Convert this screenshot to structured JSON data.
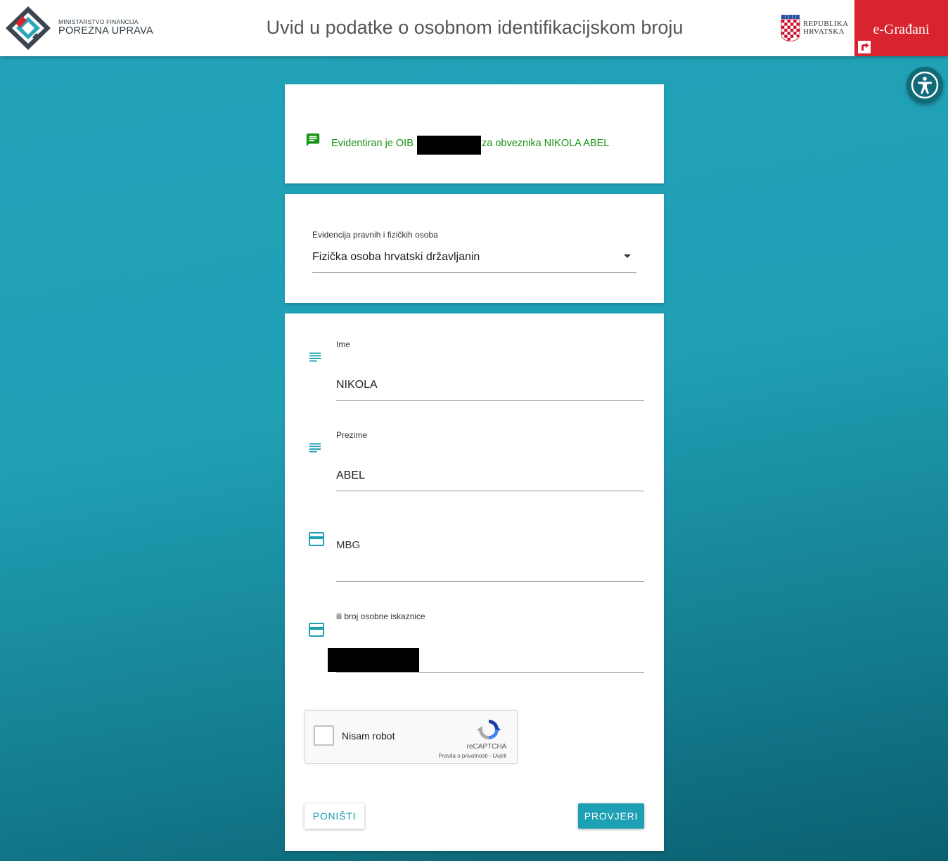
{
  "header": {
    "logo_line1": "MINISTARSTVO FINANCIJA",
    "logo_line2": "POREZNA UPRAVA",
    "title": "Uvid u podatke o osobnom identifikacijskom broju",
    "republic_line1": "REPUBLIKA",
    "republic_line2": "HRVATSKA",
    "egradjani_label": "e-Građani"
  },
  "message": {
    "text_before": "Evidentiran je OIB",
    "text_after": "za obveznika NIKOLA ABEL",
    "icon": "message-icon",
    "color": "#179317"
  },
  "registry_select": {
    "label": "Evidencija pravnih i fizičkih osoba",
    "value": "Fizička osoba hrvatski državljanin"
  },
  "form": {
    "first_name": {
      "label": "Ime",
      "value": "NIKOLA",
      "icon": "subject-icon"
    },
    "last_name": {
      "label": "Prezime",
      "value": "ABEL",
      "icon": "subject-icon"
    },
    "mbg": {
      "placeholder": "MBG",
      "value": "",
      "icon": "credit-card-icon"
    },
    "id_card": {
      "label": "ili broj osobne iskaznice",
      "icon": "credit-card-icon"
    }
  },
  "captcha": {
    "label": "Nisam robot",
    "brand": "reCAPTCHA",
    "links": "Pravila o privatnosti - Uvjeti"
  },
  "buttons": {
    "reset": "PONIŠTI",
    "submit": "PROVJERI"
  },
  "colors": {
    "accent": "#1d9fb4",
    "header_red": "#d9232e",
    "success_green": "#179317"
  }
}
